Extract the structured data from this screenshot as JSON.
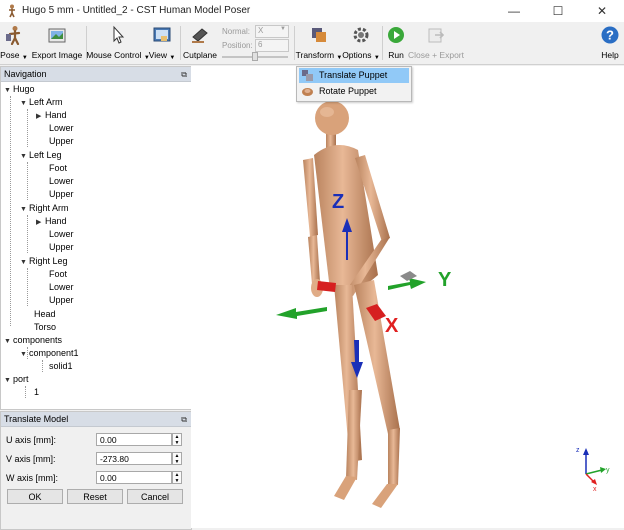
{
  "window": {
    "title": "Hugo 5 mm - Untitled_2 - CST Human Model Poser",
    "minimize_icon": "minimize-icon",
    "maximize_icon": "maximize-icon",
    "close_icon": "close-icon"
  },
  "toolbar": {
    "pose": "Pose",
    "export_image": "Export Image",
    "mouse_control": "Mouse Control",
    "view": "View",
    "cutplane": "Cutplane",
    "normal_label": "Normal:",
    "normal_value": "X",
    "position_label": "Position:",
    "position_value": "6",
    "transform": "Transform",
    "options": "Options",
    "run": "Run",
    "close_export": "Close + Export",
    "help": "Help"
  },
  "transform_menu": {
    "items": [
      "Translate Puppet",
      "Rotate Puppet"
    ],
    "highlighted": "Translate Puppet"
  },
  "navigation": {
    "title": "Navigation",
    "tree": {
      "hugo": "Hugo",
      "left_arm": "Left Arm",
      "left_arm_hand": "Hand",
      "left_arm_lower": "Lower",
      "left_arm_upper": "Upper",
      "left_leg": "Left Leg",
      "left_leg_foot": "Foot",
      "left_leg_lower": "Lower",
      "left_leg_upper": "Upper",
      "right_arm": "Right Arm",
      "right_arm_hand": "Hand",
      "right_arm_lower": "Lower",
      "right_arm_upper": "Upper",
      "right_leg": "Right Leg",
      "right_leg_foot": "Foot",
      "right_leg_lower": "Lower",
      "right_leg_upper": "Upper",
      "head": "Head",
      "torso": "Torso",
      "components": "components",
      "component1": "component1",
      "solid1": "solid1",
      "port": "port",
      "port_1": "1"
    }
  },
  "translate_model": {
    "title": "Translate Model",
    "u_label": "U axis [mm]:",
    "u_value": "0.00",
    "v_label": "V axis [mm]:",
    "v_value": "-273.80",
    "w_label": "W axis [mm]:",
    "w_value": "0.00",
    "ok": "OK",
    "reset": "Reset",
    "cancel": "Cancel"
  },
  "viewport": {
    "axis_z": "Z",
    "axis_y": "Y",
    "axis_x": "X",
    "triad_z": "z",
    "triad_y": "y",
    "triad_x": "x",
    "colors": {
      "z_axis": "#1a2fb8",
      "y_axis": "#22a22a",
      "x_axis": "#e02020",
      "skin": "#d9a27a"
    }
  }
}
